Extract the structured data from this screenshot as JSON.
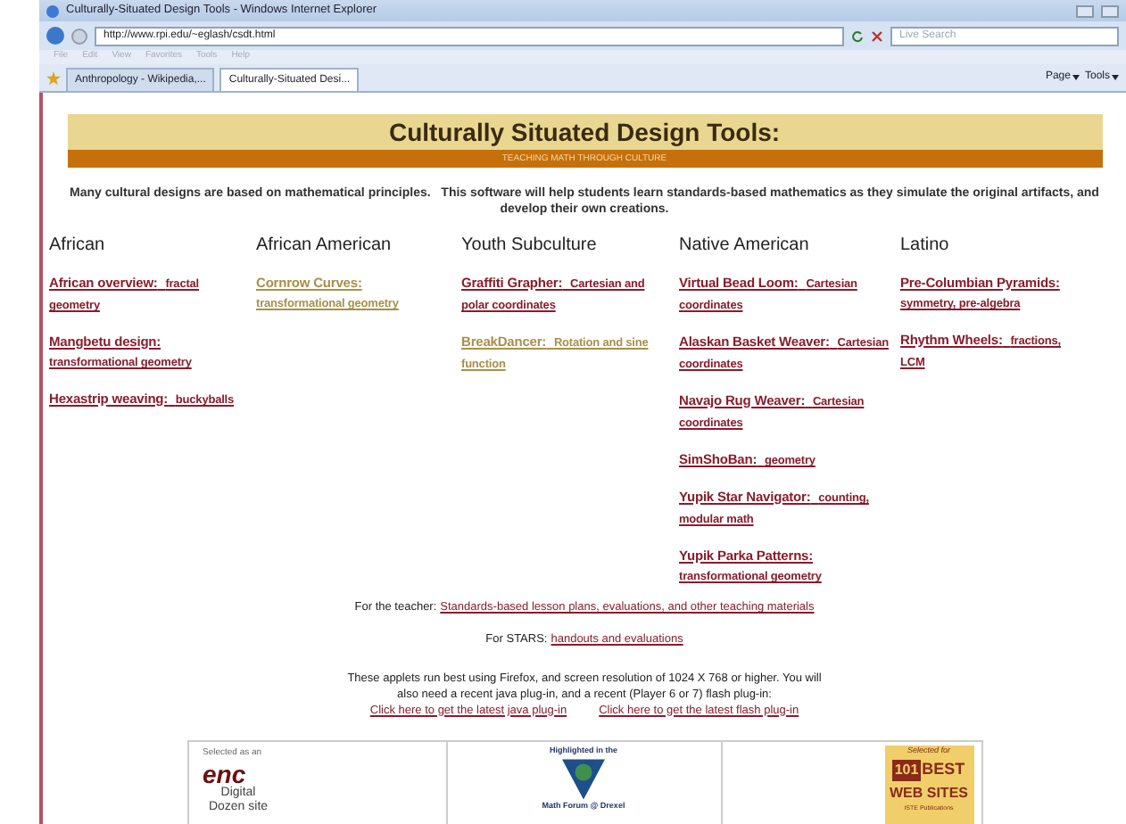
{
  "window": {
    "title": "Culturally-Situated Design Tools - Windows Internet Explorer"
  },
  "address_bar": {
    "url": "http://www.rpi.edu/~eglash/csdt.html"
  },
  "search": {
    "placeholder": "Live Search"
  },
  "menu": [
    "File",
    "Edit",
    "View",
    "Favorites",
    "Tools",
    "Help"
  ],
  "tabs": [
    {
      "label": "Anthropology - Wikipedia,...",
      "selected": false
    },
    {
      "label": "Culturally-Situated Desi...",
      "selected": true
    }
  ],
  "toolbar": [
    "Page",
    "Tools"
  ],
  "header": {
    "title": "Culturally Situated Design Tools:",
    "subtitle": "TEACHING MATH THROUGH CULTURE"
  },
  "intro": "Many cultural designs are based on mathematical principles.   This software will help students learn standards-based mathematics as they simulate the original artifacts, and develop their own creations.",
  "columns": [
    {
      "heading": "African",
      "links": [
        {
          "title": "African overview:",
          "subtitle": "fractal geometry",
          "visited": false
        },
        {
          "title": "Mangbetu design:",
          "subtitle": "transformational geometry",
          "visited": false
        },
        {
          "title": "Hexastrip weaving:",
          "subtitle": "buckyballs",
          "visited": false
        }
      ]
    },
    {
      "heading": "African American",
      "links": [
        {
          "title": "Cornrow Curves:",
          "subtitle": "transformational geometry",
          "visited": true
        }
      ]
    },
    {
      "heading": "Youth Subculture",
      "links": [
        {
          "title": "Graffiti Grapher:",
          "subtitle": "Cartesian and polar coordinates",
          "visited": false
        },
        {
          "title": "BreakDancer:",
          "subtitle": "Rotation and sine function",
          "visited": true
        }
      ]
    },
    {
      "heading": "Native American",
      "links": [
        {
          "title": "Virtual Bead Loom:",
          "subtitle": "Cartesian coordinates",
          "visited": false
        },
        {
          "title": "Alaskan Basket Weaver:",
          "subtitle": "Cartesian coordinates",
          "visited": false
        },
        {
          "title": "Navajo Rug Weaver:",
          "subtitle": "Cartesian coordinates",
          "visited": false
        },
        {
          "title": "SimShoBan:",
          "subtitle": "geometry",
          "visited": false
        },
        {
          "title": "Yupik Star Navigator:",
          "subtitle": "counting,  modular math",
          "visited": false
        },
        {
          "title": "Yupik Parka Patterns:",
          "subtitle": "transformational geometry",
          "visited": false
        }
      ]
    },
    {
      "heading": "Latino",
      "links": [
        {
          "title": "Pre-Columbian Pyramids:",
          "subtitle": "symmetry, pre-algebra",
          "visited": false
        },
        {
          "title": "Rhythm Wheels:",
          "subtitle": "fractions, LCM",
          "visited": false
        }
      ]
    }
  ],
  "footer": [
    {
      "label": "For the teacher:",
      "link": "Standards-based lesson plans, evaluations, and other teaching materials"
    },
    {
      "label": "For STARS:",
      "link": "handouts and evaluations"
    }
  ],
  "requirements": {
    "text": "These applets run best using Firefox, and screen resolution of 1024 X 768 or higher. You will also need a recent java plug-in, and a recent (Player 6 or 7) flash plug-in:",
    "links": [
      "Click here to get the latest java plug-in",
      "Click here to get the latest flash plug-in"
    ]
  },
  "badges": {
    "enc": {
      "caption": "Selected as an",
      "logo": "enc",
      "tagline": "Digital Dozen site"
    },
    "math_forum": {
      "caption": "Highlighted in the",
      "name": "Math Forum @ Drexel"
    },
    "best": {
      "caption": "Selected for",
      "number": "101",
      "word": "BEST",
      "line": "WEB SITES",
      "publisher": "ISTE Publications"
    }
  }
}
